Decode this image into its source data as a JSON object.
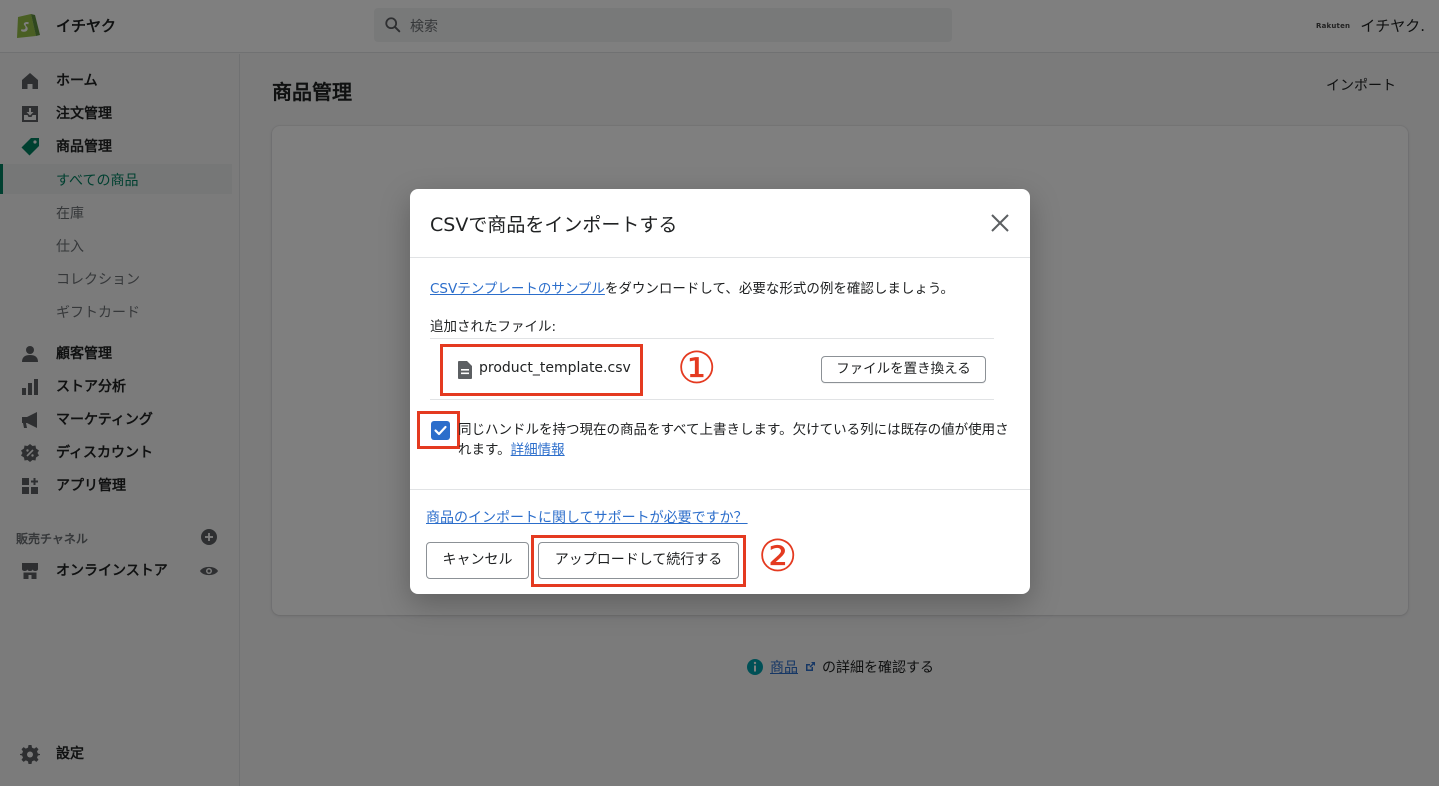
{
  "app": {
    "store_name": "イチヤク",
    "search_placeholder": "検索",
    "user_badge": "Rakuten",
    "user_name": "イチヤク."
  },
  "sidebar": {
    "items": [
      {
        "label": "ホーム",
        "icon": "home-icon"
      },
      {
        "label": "注文管理",
        "icon": "orders-icon"
      },
      {
        "label": "商品管理",
        "icon": "tag-icon"
      },
      {
        "label": "顧客管理",
        "icon": "customer-icon"
      },
      {
        "label": "ストア分析",
        "icon": "analytics-icon"
      },
      {
        "label": "マーケティング",
        "icon": "megaphone-icon"
      },
      {
        "label": "ディスカウント",
        "icon": "discount-icon"
      },
      {
        "label": "アプリ管理",
        "icon": "apps-icon"
      }
    ],
    "subitems": [
      "すべての商品",
      "在庫",
      "仕入",
      "コレクション",
      "ギフトカード"
    ],
    "active_subitem": "すべての商品",
    "channels_title": "販売チャネル",
    "online_store": "オンラインストア",
    "settings": "設定"
  },
  "main": {
    "page_title": "商品管理",
    "import_label": "インポート",
    "learn_link": "商品",
    "learn_suffix": "の詳細を確認する"
  },
  "modal": {
    "title": "CSVで商品をインポートする",
    "template_link": "CSVテンプレートのサンプル",
    "template_suffix": "をダウンロードして、必要な形式の例を確認しましょう。",
    "added_file_label": "追加されたファイル:",
    "file_name": "product_template.csv",
    "replace_button": "ファイルを置き換える",
    "overwrite_checked": true,
    "overwrite_text": "同じハンドルを持つ現在の商品をすべて上書きします。欠けている列には既存の値が使用されます。",
    "details_link": "詳細情報",
    "help_link": "商品のインポートに関してサポートが必要ですか？",
    "cancel_button": "キャンセル",
    "upload_button": "アップロードして続行する",
    "annotation_1": "①",
    "annotation_2": "②"
  },
  "colors": {
    "brand_green": "#008060",
    "link_blue": "#2c6ecb",
    "annotation_red": "#e43a20"
  }
}
